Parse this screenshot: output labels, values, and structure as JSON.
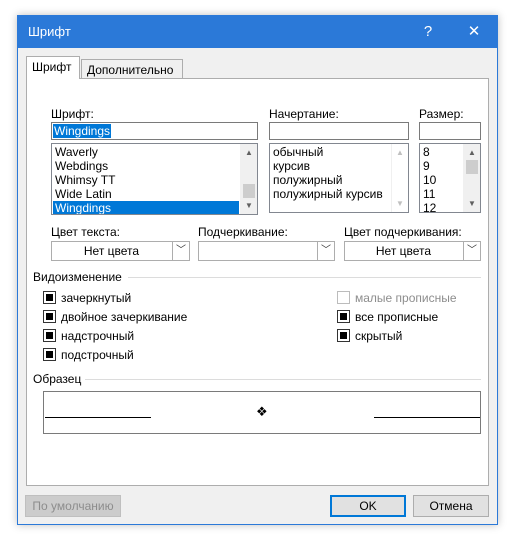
{
  "window": {
    "title": "Шрифт",
    "help_glyph": "?",
    "close_glyph": "✕"
  },
  "tabs": [
    {
      "label": "Шрифт",
      "active": true
    },
    {
      "label": "Дополнительно",
      "active": false
    }
  ],
  "font": {
    "label": "Шрифт:",
    "value": "Wingdings",
    "list": [
      "Waverly",
      "Webdings",
      "Whimsy TT",
      "Wide Latin",
      "Wingdings"
    ],
    "selected_index": 4
  },
  "style": {
    "label": "Начертание:",
    "value": "",
    "list": [
      "обычный",
      "курсив",
      "полужирный",
      "полужирный курсив"
    ]
  },
  "size": {
    "label": "Размер:",
    "value": "",
    "list": [
      "8",
      "9",
      "10",
      "11",
      "12"
    ]
  },
  "text_color": {
    "label": "Цвет текста:",
    "value": "Нет цвета"
  },
  "underline": {
    "label": "Подчеркивание:",
    "value": ""
  },
  "underline_color": {
    "label": "Цвет подчеркивания:",
    "value": "Нет цвета"
  },
  "effects": {
    "heading": "Видоизменение",
    "left": [
      {
        "label": "зачеркнутый",
        "checked": true,
        "enabled": true
      },
      {
        "label": "двойное зачеркивание",
        "checked": true,
        "enabled": true
      },
      {
        "label": "надстрочный",
        "checked": true,
        "enabled": true
      },
      {
        "label": "подстрочный",
        "checked": true,
        "enabled": true
      }
    ],
    "right": [
      {
        "label": "малые прописные",
        "checked": false,
        "enabled": false
      },
      {
        "label": "все прописные",
        "checked": true,
        "enabled": true
      },
      {
        "label": "скрытый",
        "checked": true,
        "enabled": true
      }
    ]
  },
  "preview": {
    "heading": "Образец",
    "sample": "❖"
  },
  "buttons": {
    "default": "По умолчанию",
    "ok": "OK",
    "cancel": "Отмена"
  },
  "icons": {
    "scroll_up": "▲",
    "scroll_down": "▼",
    "combo_arrow": "﹀"
  },
  "colors": {
    "accent": "#2b79d8",
    "selection": "#0078d7",
    "dialog_bg": "#f0f0f0"
  }
}
